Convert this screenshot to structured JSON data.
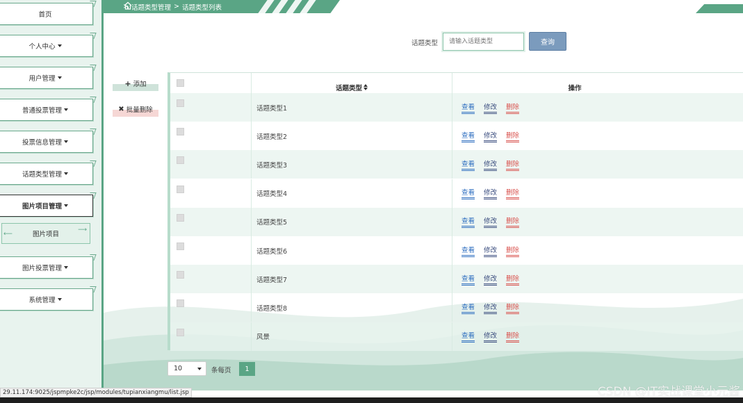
{
  "breadcrumb": {
    "sep": ">",
    "level1": "话题类型管理",
    "level2": "话题类型列表"
  },
  "sidebar": {
    "items": [
      {
        "label": "首页",
        "has_caret": false
      },
      {
        "label": "个人中心",
        "has_caret": true
      },
      {
        "label": "用户管理",
        "has_caret": true
      },
      {
        "label": "普通投票管理",
        "has_caret": true
      },
      {
        "label": "投票信息管理",
        "has_caret": true
      },
      {
        "label": "话题类型管理",
        "has_caret": true
      },
      {
        "label": "图片项目管理",
        "has_caret": true,
        "active": true
      },
      {
        "label": "图片投票管理",
        "has_caret": true
      },
      {
        "label": "系统管理",
        "has_caret": true
      }
    ],
    "submenu": {
      "label": "图片项目"
    }
  },
  "search": {
    "label": "话题类型",
    "placeholder": "请输入话题类型",
    "button": "查询"
  },
  "actions": {
    "add": "添加",
    "batch_delete": "批量删除"
  },
  "table": {
    "headers": {
      "type": "话题类型",
      "ops": "操作"
    },
    "op_labels": {
      "view": "查看",
      "edit": "修改",
      "delete": "删除"
    },
    "rows": [
      "话题类型1",
      "话题类型2",
      "话题类型3",
      "话题类型4",
      "话题类型5",
      "话题类型6",
      "话题类型7",
      "话题类型8",
      "风景"
    ]
  },
  "pagination": {
    "page_size": "10",
    "per_page_label": "条每页",
    "current_page": "1"
  },
  "statusbar": {
    "url": "29.11.174:9025/jspmpke2c/jsp/modules/tupianxiangmu/list.jsp"
  },
  "watermark": "CSDN @IT实战课堂小元酱",
  "colors": {
    "accent": "#5aa585",
    "view": "#2f6fc0",
    "edit": "#3d4f80",
    "delete": "#d9534f",
    "search_button": "#7b9bbd"
  }
}
